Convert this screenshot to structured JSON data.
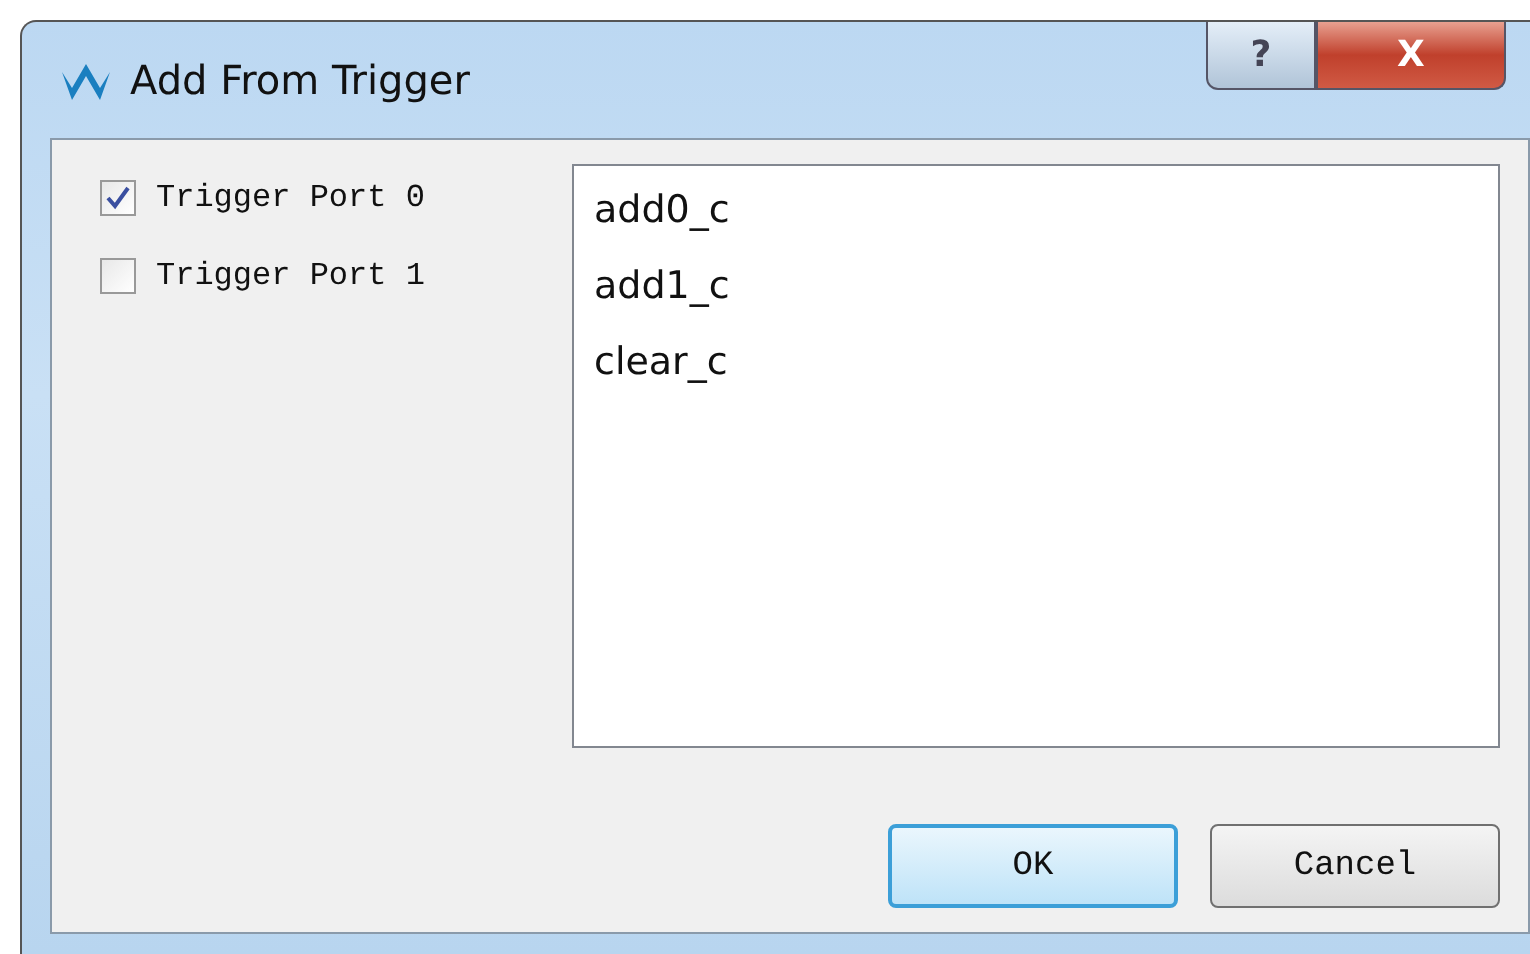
{
  "window": {
    "title": "Add From Trigger",
    "title_buttons": [
      {
        "kind": "help",
        "label": "?"
      },
      {
        "kind": "close",
        "label": "X"
      }
    ]
  },
  "ports": [
    {
      "label": "Trigger Port 0",
      "checked": true
    },
    {
      "label": "Trigger Port 1",
      "checked": false
    }
  ],
  "signals": [
    "add0_c",
    "add1_c",
    "clear_c"
  ],
  "buttons": [
    {
      "label": "OK",
      "default": true
    },
    {
      "label": "Cancel",
      "default": false
    }
  ]
}
